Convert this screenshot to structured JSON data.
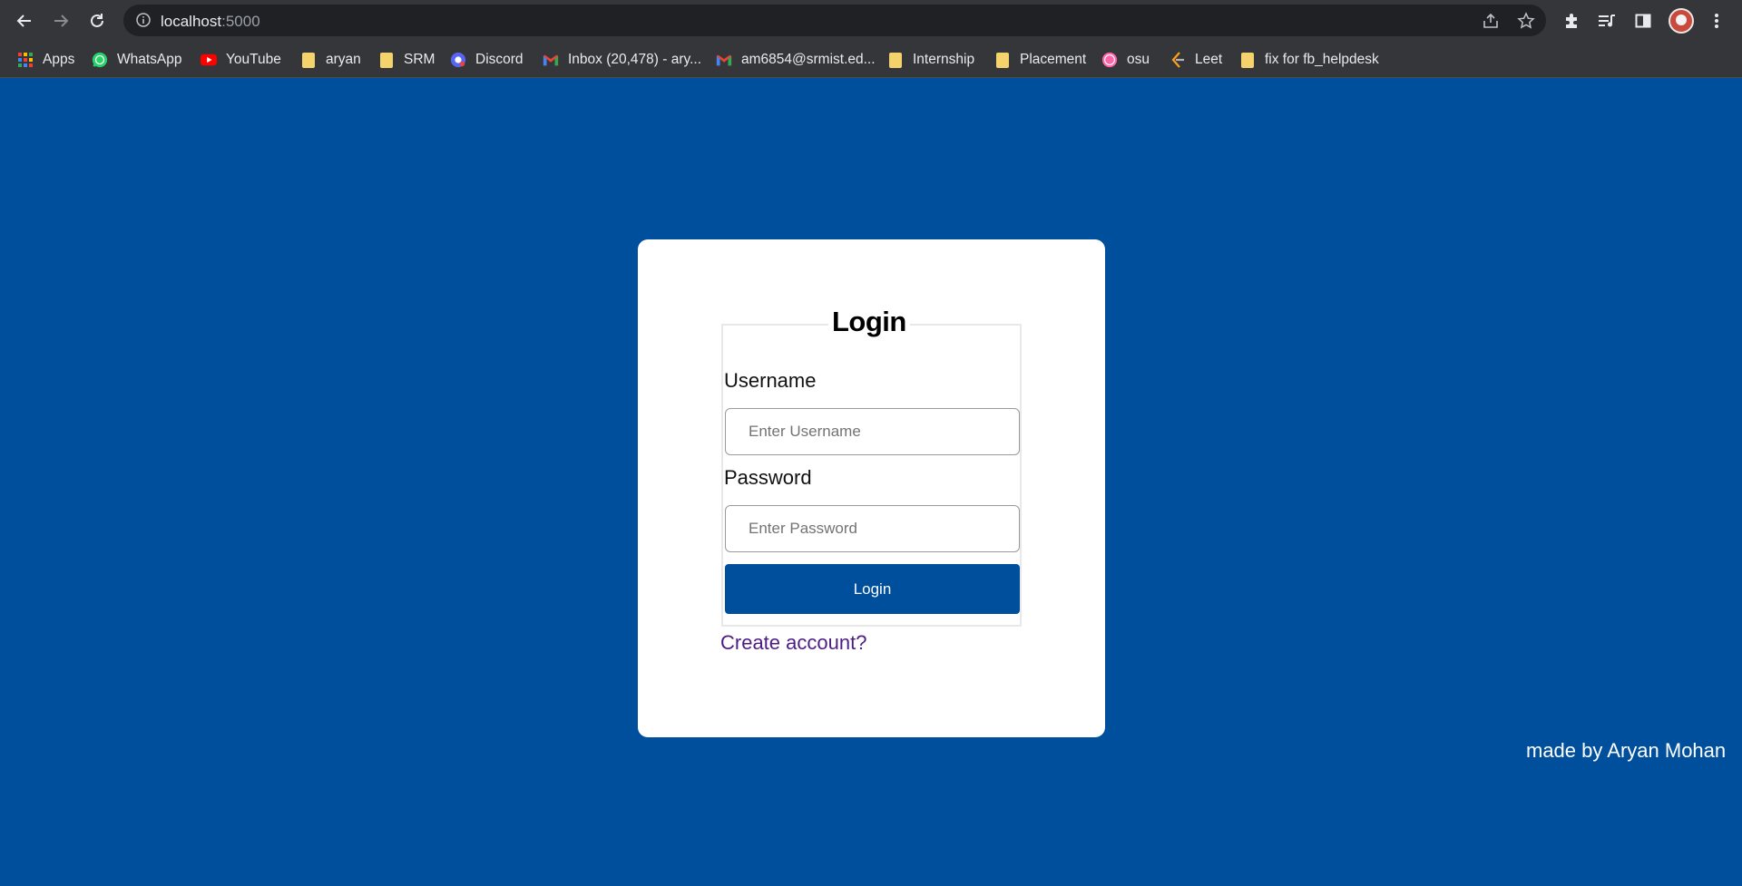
{
  "browser": {
    "url_host": "localhost",
    "url_port": ":5000",
    "bookmarks": [
      {
        "label": "Apps",
        "icon": "apps-grid-icon"
      },
      {
        "label": "WhatsApp",
        "icon": "whatsapp-icon"
      },
      {
        "label": "YouTube",
        "icon": "youtube-icon"
      },
      {
        "label": "aryan",
        "icon": "folder-icon"
      },
      {
        "label": "SRM",
        "icon": "folder-icon"
      },
      {
        "label": "Discord",
        "icon": "discord-icon"
      },
      {
        "label": "Inbox (20,478) - ary...",
        "icon": "gmail-icon"
      },
      {
        "label": "am6854@srmist.ed...",
        "icon": "gmail-icon"
      },
      {
        "label": "Internship",
        "icon": "folder-icon"
      },
      {
        "label": "Placement",
        "icon": "folder-icon"
      },
      {
        "label": "osu",
        "icon": "osu-icon"
      },
      {
        "label": "Leet",
        "icon": "leetcode-icon"
      },
      {
        "label": "fix for fb_helpdesk",
        "icon": "folder-icon"
      }
    ]
  },
  "login": {
    "title": "Login",
    "username_label": "Username",
    "username_placeholder": "Enter Username",
    "password_label": "Password",
    "password_placeholder": "Enter Password",
    "submit_label": "Login",
    "create_account": "Create account?"
  },
  "footer": {
    "credit": "made by Aryan Mohan"
  },
  "colors": {
    "background": "#004f9c",
    "button": "#004f9c",
    "link": "#4d1d86"
  }
}
